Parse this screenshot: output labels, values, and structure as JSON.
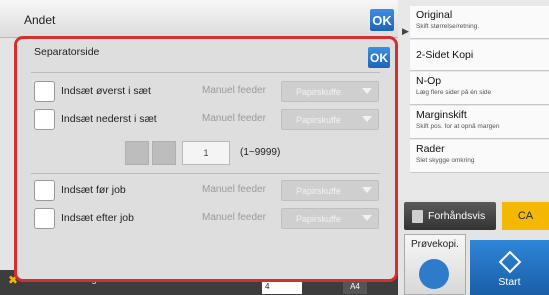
{
  "window": {
    "title": "Andet",
    "ok_label": "OK"
  },
  "sidemenu": {
    "items": [
      {
        "title": "Original",
        "subtitle": "Skift størrelse/retning."
      },
      {
        "title": "2-Sidet Kopi",
        "subtitle": ""
      },
      {
        "title": "N-Op",
        "subtitle": "Læg flere sider på én side"
      },
      {
        "title": "Marginskift",
        "subtitle": "Skift pos. for at opnå margen"
      },
      {
        "title": "Rader",
        "subtitle": "Slet skygge omkring"
      }
    ],
    "preview_label": "Forhåndsvis",
    "ca_label": "CA",
    "proof_label": "Prøvekopi.",
    "start_label": "Start"
  },
  "bottombar": {
    "back_label": "Tilbage",
    "page_value": "4",
    "paper_label": "A4"
  },
  "dialog": {
    "title": "Separatorside",
    "ok_label": "OK",
    "rows_top": [
      {
        "label": "Indsæt øverst i sæt",
        "feeder": "Manuel feeder",
        "paper": "Papirskuffe",
        "checked": false
      },
      {
        "label": "Indsæt nederst i sæt",
        "feeder": "Manuel feeder",
        "paper": "Papirskuffe",
        "checked": false
      }
    ],
    "stepper": {
      "value": "1",
      "range": "(1~9999)"
    },
    "rows_bottom": [
      {
        "label": "Indsæt før job",
        "feeder": "Manuel feeder",
        "paper": "Papirskuffe",
        "checked": false
      },
      {
        "label": "Indsæt efter job",
        "feeder": "Manuel feeder",
        "paper": "Papirskuffe",
        "checked": false
      }
    ]
  },
  "colors": {
    "highlight_border": "#d32f2f",
    "accent_blue": "#1e64b8",
    "ca_yellow": "#f5b800"
  }
}
